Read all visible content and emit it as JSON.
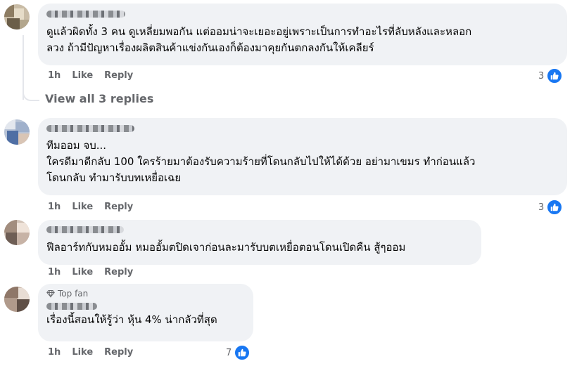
{
  "comments": [
    {
      "text": "ดูแล้วผิดทั้ง 3 คน ดูเหลี่ยมพอกัน แต่ออมน่าจะเยอะอยู่เพราะเป็นการทำอะไรที่ลับหลังและหลอก\nลวง ถ้ามีปัญหาเรื่องผลิตสินค้าแข่งกันเองก็ต้องมาคุยกันตกลงกันให้เคลียร์",
      "time": "1h",
      "like_label": "Like",
      "reply_label": "Reply",
      "reaction_count": "3"
    },
    {
      "text": "ทีมออม จบ...\nใครดีมาดีกลับ 100 ใครร้ายมาต้องรับความร้ายที่โดนกลับไปให้ได้ด้วย อย่ามาเขมร ทำก่อนแล้ว\nโดนกลับ ทำมารับบทเหยื่อเฉย",
      "time": "1h",
      "like_label": "Like",
      "reply_label": "Reply",
      "reaction_count": "3"
    },
    {
      "text": "ฟีลอาร์ทกับหมออั้ม หมออั้มตปิดเจาก่อนละมารับบตเหยื่อตอนโดนเปิดคืน สู้ๆออม",
      "time": "1h",
      "like_label": "Like",
      "reply_label": "Reply",
      "reaction_count": ""
    },
    {
      "badge": "Top fan",
      "text": "เรื่องนี้สอนให้รู้ว่า หุ้น 4% น่ากลัวที่สุด",
      "time": "1h",
      "like_label": "Like",
      "reply_label": "Reply",
      "reaction_count": "7"
    }
  ],
  "view_replies_label": "View all 3 replies",
  "colors": {
    "bubble": "#f0f2f5",
    "meta": "#65676b",
    "like_blue": "#1877f2"
  },
  "icons": [
    "like-thumb-icon",
    "diamond-icon"
  ]
}
